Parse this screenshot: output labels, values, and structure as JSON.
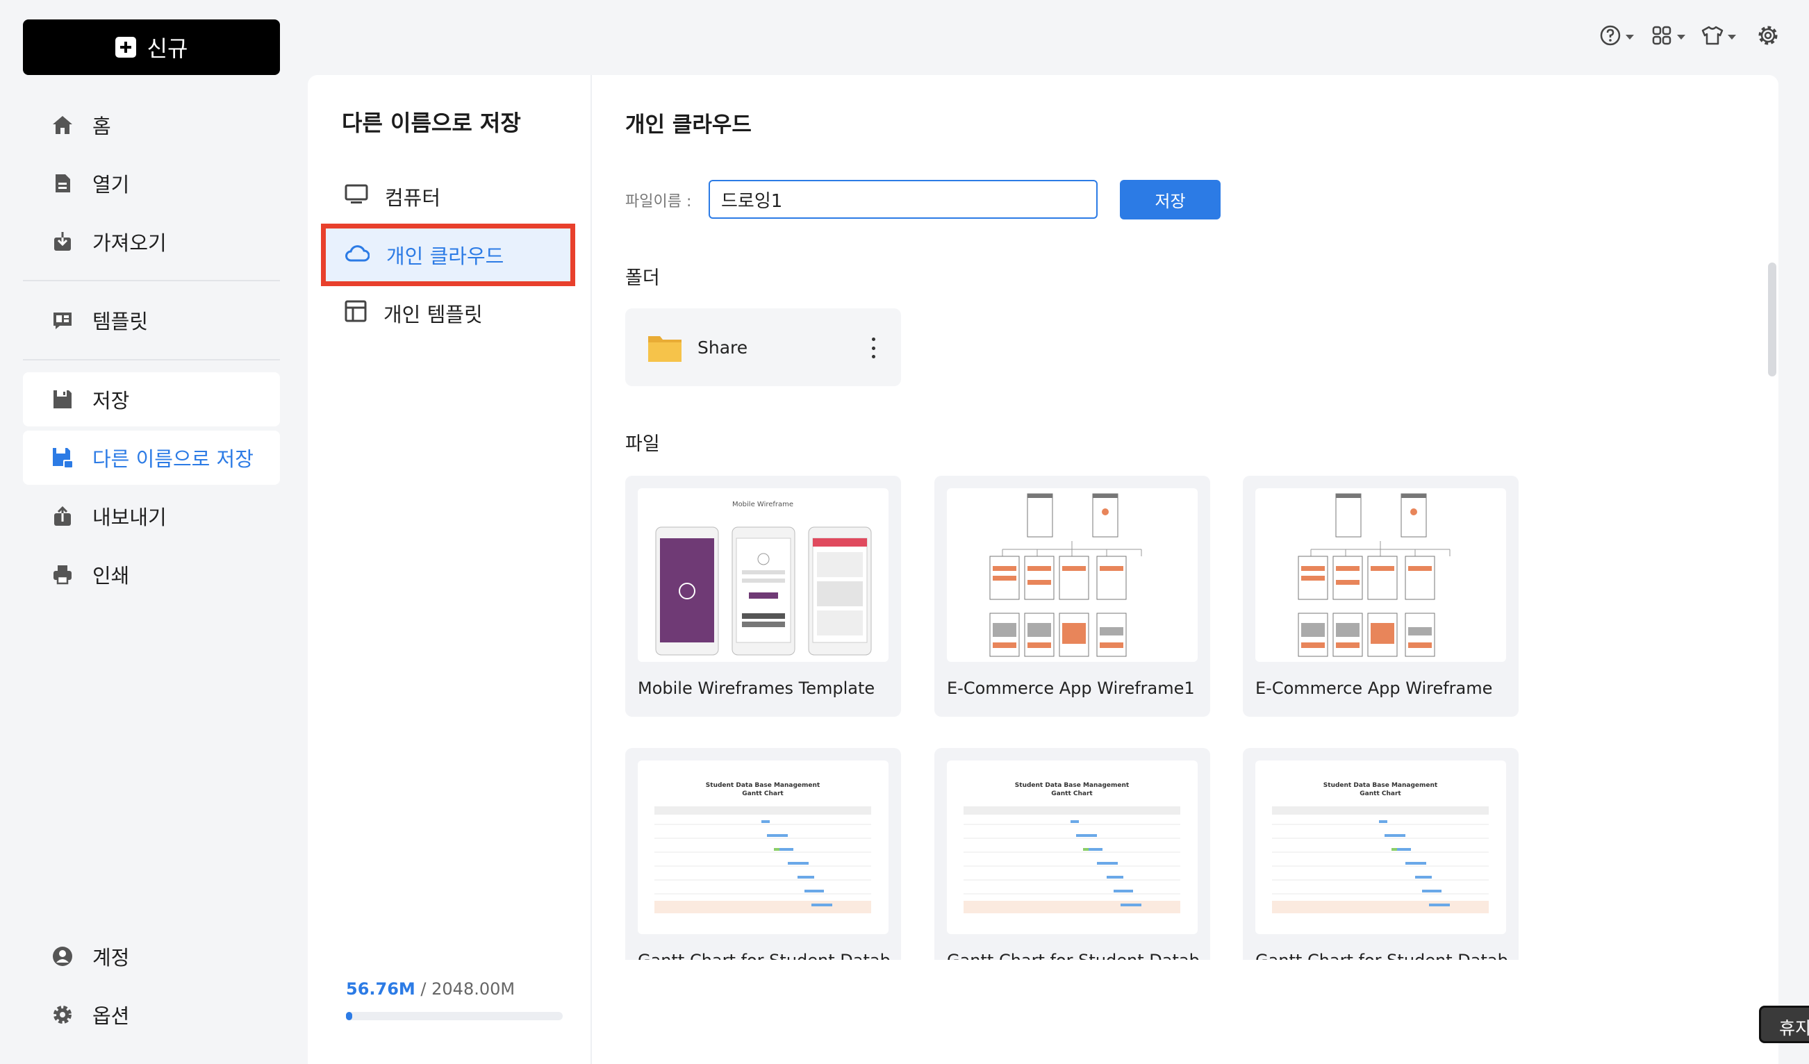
{
  "sidebar": {
    "new_label": "신규",
    "items": [
      {
        "label": "홈",
        "icon": "home-icon"
      },
      {
        "label": "열기",
        "icon": "file-open-icon"
      },
      {
        "label": "가져오기",
        "icon": "import-icon"
      },
      {
        "label": "템플릿",
        "icon": "template-icon"
      },
      {
        "label": "저장",
        "icon": "save-icon"
      },
      {
        "label": "다른 이름으로 저장",
        "icon": "save-as-icon"
      },
      {
        "label": "내보내기",
        "icon": "export-icon"
      },
      {
        "label": "인쇄",
        "icon": "print-icon"
      }
    ],
    "bottom": [
      {
        "label": "계정",
        "icon": "account-icon"
      },
      {
        "label": "옵션",
        "icon": "gear-icon"
      }
    ]
  },
  "save_panel": {
    "title": "다른 이름으로 저장",
    "locations": [
      {
        "label": "컴퓨터",
        "icon": "monitor-icon"
      },
      {
        "label": "개인 클라우드",
        "icon": "cloud-icon"
      },
      {
        "label": "개인 템플릿",
        "icon": "layout-icon"
      }
    ],
    "storage": {
      "used": "56.76M",
      "total": " / 2048.00M",
      "fraction": 0.028
    }
  },
  "content": {
    "title": "개인 클라우드",
    "filename_label": "파일이름 :",
    "filename_value": "드로잉1",
    "save_label": "저장",
    "folders_label": "폴더",
    "folders": [
      {
        "name": "Share"
      }
    ],
    "files_label": "파일",
    "files": [
      {
        "name": "Mobile Wireframes Template",
        "thumb": "mobile"
      },
      {
        "name": "E-Commerce App Wireframe1",
        "thumb": "ecommerce"
      },
      {
        "name": "E-Commerce App Wireframe",
        "thumb": "ecommerce"
      },
      {
        "name": "Gantt Chart for Student Datab",
        "thumb": "gantt"
      },
      {
        "name": "Gantt Chart for Student Datab",
        "thumb": "gantt"
      },
      {
        "name": "Gantt Chart for Student Datab",
        "thumb": "gantt"
      }
    ],
    "thumb_text": {
      "mobile_title": "Mobile Wireframe",
      "gantt_title_1": "Student Data Base Management",
      "gantt_title_2": "Gantt Chart"
    }
  },
  "toolbar": {
    "icons": [
      "help-icon",
      "apps-icon",
      "theme-icon",
      "settings-icon"
    ]
  },
  "chip_label": "휴지",
  "colors": {
    "accent": "#2c7be5",
    "highlight": "#e8402c",
    "folder": "#f6c34a",
    "thumb_orange": "#e8855a"
  }
}
